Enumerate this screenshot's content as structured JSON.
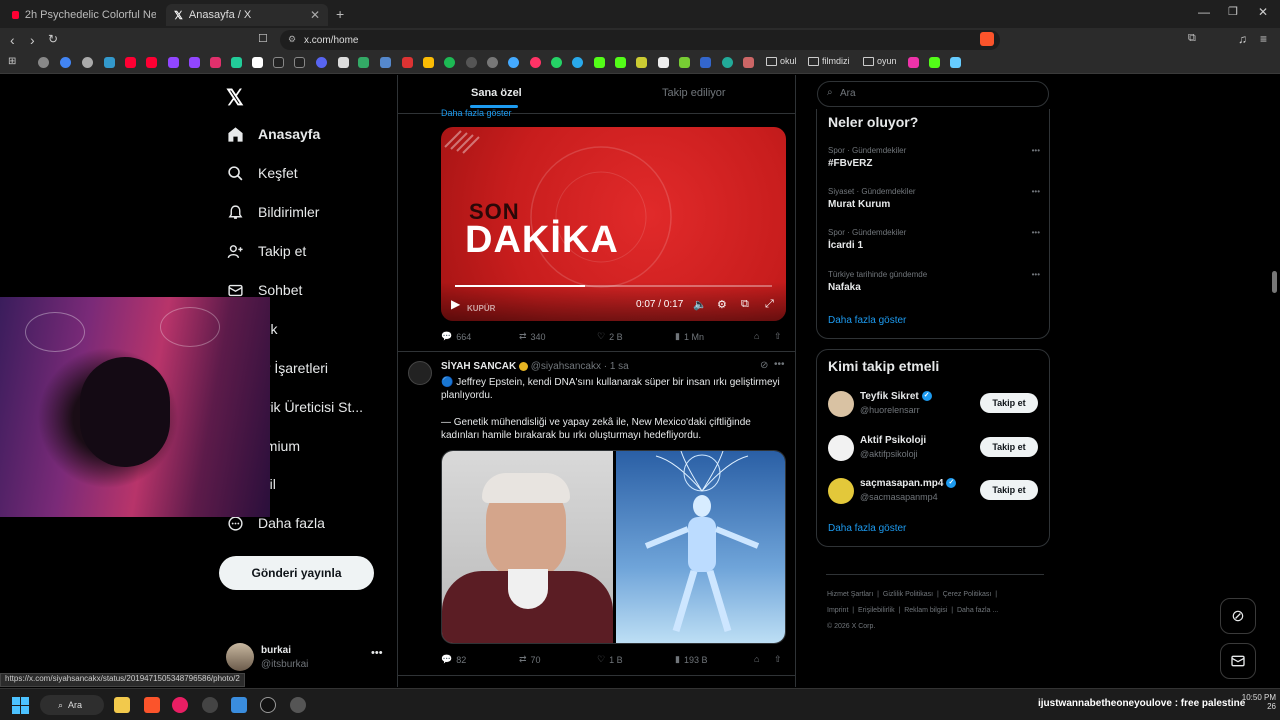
{
  "browser": {
    "tabs": [
      {
        "title": "2h Psychedelic Colorful Neon Backgr...",
        "favicon_color": "#ff0033"
      },
      {
        "title": "Anasayfa / X",
        "favicon_color": "#ffffff"
      }
    ],
    "url": "x.com/home",
    "bookmark_folders": [
      "okul",
      "filmdizi",
      "oyun"
    ],
    "status_url": "https://x.com/siyahsancakx/status/2019471505348796586/photo/2"
  },
  "sidebar": {
    "items": [
      {
        "label": "Anasayfa",
        "icon": "home-icon"
      },
      {
        "label": "Keşfet",
        "icon": "search-icon"
      },
      {
        "label": "Bildirimler",
        "icon": "bell-icon"
      },
      {
        "label": "Takip et",
        "icon": "follow-icon"
      },
      {
        "label": "Sohbet",
        "icon": "mail-icon"
      },
      {
        "label": "rok",
        "icon": "grok-icon"
      },
      {
        "label": "er İşaretleri",
        "icon": "bookmark-icon"
      },
      {
        "label": "erik Üreticisi St...",
        "icon": "creator-icon"
      },
      {
        "label": "emium",
        "icon": "premium-icon"
      },
      {
        "label": "ofil",
        "icon": "profile-icon"
      },
      {
        "label": "Daha fazla",
        "icon": "more-icon"
      }
    ],
    "post_button": "Gönderi yayınla",
    "user": {
      "name": "burkai",
      "handle": "@itsburkai"
    }
  },
  "feed": {
    "tabs": [
      "Sana özel",
      "Takip ediliyor"
    ],
    "show_more_top": "Daha fazla göster",
    "video": {
      "time": "0:07 / 0:17",
      "headline_top": "SON",
      "headline_main": "DAKİKA",
      "brand": "KUPÜR",
      "progress": 0.41
    },
    "tweet1_actions": {
      "replies": "664",
      "reposts": "340",
      "likes": "2 B",
      "views": "1 Mn"
    },
    "tweet2": {
      "author": "SİYAH SANCAK",
      "handle": "@siyahsancakx",
      "time": "· 1 sa",
      "text1": "🔵 Jeffrey Epstein, kendi DNA'sını kullanarak süper bir insan ırkı geliştirmeyi planlıyordu.",
      "text2": "— Genetik mühendisliği ve yapay zekâ ile, New Mexico'daki çiftliğinde kadınları hamile bırakarak bu ırkı oluşturmayı hedefliyordu.",
      "actions": {
        "replies": "82",
        "reposts": "70",
        "likes": "1 B",
        "views": "193 B"
      }
    }
  },
  "right": {
    "search_placeholder": "Ara",
    "trends_title": "Neler oluyor?",
    "trends": [
      {
        "meta": "Spor · Gündemdekiler",
        "name": "#FBvERZ"
      },
      {
        "meta": "Siyaset · Gündemdekiler",
        "name": "Murat Kurum"
      },
      {
        "meta": "Spor · Gündemdekiler",
        "name": "İcardi 1"
      },
      {
        "meta": "Türkiye tarihinde gündemde",
        "name": "Nafaka"
      }
    ],
    "trends_more": "Daha fazla göster",
    "who_title": "Kimi takip etmeli",
    "who": [
      {
        "name": "Teyfik Sikret",
        "handle": "@huorelensarr",
        "verified": true,
        "btn": "Takip et"
      },
      {
        "name": "Aktif Psikoloji",
        "handle": "@aktifpsikoloji",
        "verified": false,
        "btn": "Takip et"
      },
      {
        "name": "saçmasapan.mp4",
        "handle": "@sacmasapanmp4",
        "verified": true,
        "btn": "Takip et"
      }
    ],
    "who_more": "Daha fazla göster",
    "footer": [
      "Hizmet Şartları",
      "Gizlilik Politikası",
      "Çerez Politikası",
      "Imprint",
      "Erişilebilirlik",
      "Reklam bilgisi",
      "Daha fazla ...",
      "© 2026 X Corp."
    ]
  },
  "taskbar": {
    "search": "Ara",
    "ticker": "ijustwannabetheoneyoulove : free palestine",
    "time": "10:50 PM",
    "date": "26"
  }
}
